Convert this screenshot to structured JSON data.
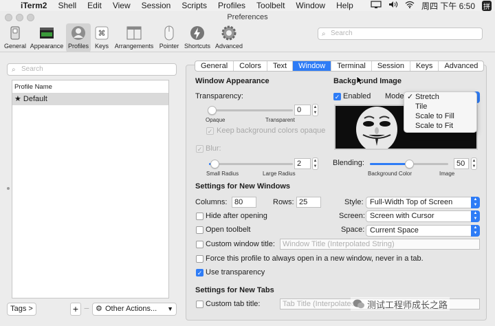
{
  "menubar": {
    "apple": "",
    "app": "iTerm2",
    "items": [
      "Shell",
      "Edit",
      "View",
      "Session",
      "Scripts",
      "Profiles",
      "Toolbelt",
      "Window",
      "Help"
    ],
    "clock": "周四 下午 6:50",
    "input_method": "拼"
  },
  "window": {
    "title": "Preferences"
  },
  "toolbar": {
    "items": [
      {
        "label": "General",
        "icon": "switch-icon"
      },
      {
        "label": "Appearance",
        "icon": "appearance-icon"
      },
      {
        "label": "Profiles",
        "icon": "profiles-icon",
        "selected": true
      },
      {
        "label": "Keys",
        "icon": "command-key-icon"
      },
      {
        "label": "Arrangements",
        "icon": "arrangements-icon"
      },
      {
        "label": "Pointer",
        "icon": "mouse-icon"
      },
      {
        "label": "Shortcuts",
        "icon": "lightning-icon"
      },
      {
        "label": "Advanced",
        "icon": "gear-icon"
      }
    ],
    "search_placeholder": "Search"
  },
  "profiles": {
    "search_placeholder": "Search",
    "column_header": "Profile Name",
    "rows": [
      {
        "name": "Default",
        "default": true
      }
    ],
    "tags_label": "Tags >",
    "add_label": "+",
    "remove_label": "−",
    "other_actions_label": "Other Actions..."
  },
  "tabs": [
    "General",
    "Colors",
    "Text",
    "Window",
    "Terminal",
    "Session",
    "Keys",
    "Advanced"
  ],
  "selected_tab": "Window",
  "window_appearance": {
    "title": "Window Appearance",
    "transparency_label": "Transparency:",
    "transparency_value": "0",
    "min_label": "Opaque",
    "max_label": "Transparent",
    "keep_bg_label": "Keep background colors opaque",
    "blur_label": "Blur:",
    "blur_value": "2",
    "blur_min": "Small Radius",
    "blur_max": "Large Radius"
  },
  "background_image": {
    "title": "Background Image",
    "enabled_label": "Enabled",
    "mode_label": "Mode",
    "mode_options": [
      "Stretch",
      "Tile",
      "Scale to Fill",
      "Scale to Fit"
    ],
    "selected_mode": "Stretch",
    "blending_label": "Blending:",
    "blending_value": "50",
    "blending_min": "Background Color",
    "blending_max": "Image"
  },
  "new_windows": {
    "title": "Settings for New Windows",
    "columns_label": "Columns:",
    "columns_value": "80",
    "rows_label": "Rows:",
    "rows_value": "25",
    "style_label": "Style:",
    "style_value": "Full-Width Top of Screen",
    "screen_label": "Screen:",
    "screen_value": "Screen with Cursor",
    "space_label": "Space:",
    "space_value": "Current Space",
    "hide_label": "Hide after opening",
    "toolbelt_label": "Open toolbelt",
    "custom_title_label": "Custom window title:",
    "custom_title_placeholder": "Window Title (Interpolated String)",
    "force_new_label": "Force this profile to always open in a new window, never in a tab.",
    "use_transparency_label": "Use transparency"
  },
  "new_tabs": {
    "title": "Settings for New Tabs",
    "custom_tab_label": "Custom tab title:",
    "custom_tab_placeholder": "Tab Title (Interpolated"
  },
  "watermark": "测试工程师成长之路"
}
